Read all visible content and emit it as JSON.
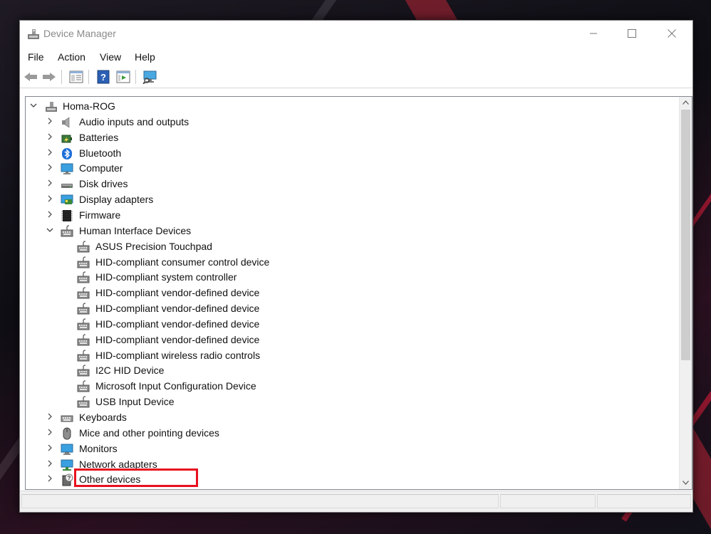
{
  "window": {
    "title": "Device Manager"
  },
  "menu": {
    "items": [
      "File",
      "Action",
      "View",
      "Help"
    ]
  },
  "toolbar": {
    "buttons": [
      "back-icon",
      "forward-icon",
      "properties-icon",
      "help-icon",
      "update-driver-icon",
      "scan-hardware-icon"
    ]
  },
  "tree": {
    "root": "Homa-ROG",
    "categories_before": [
      {
        "label": "Audio inputs and outputs",
        "icon": "speaker-icon"
      },
      {
        "label": "Batteries",
        "icon": "battery-icon"
      },
      {
        "label": "Bluetooth",
        "icon": "bluetooth-icon"
      },
      {
        "label": "Computer",
        "icon": "computer-icon"
      },
      {
        "label": "Disk drives",
        "icon": "disk-drive-icon"
      },
      {
        "label": "Display adapters",
        "icon": "display-adapter-icon"
      },
      {
        "label": "Firmware",
        "icon": "firmware-icon"
      }
    ],
    "expanded_category": {
      "label": "Human Interface Devices",
      "icon": "hid-icon"
    },
    "hid_children": [
      "ASUS Precision Touchpad",
      "HID-compliant consumer control device",
      "HID-compliant system controller",
      "HID-compliant vendor-defined device",
      "HID-compliant vendor-defined device",
      "HID-compliant vendor-defined device",
      "HID-compliant vendor-defined device",
      "HID-compliant wireless radio controls",
      "I2C HID Device",
      "Microsoft Input Configuration Device",
      "USB Input Device"
    ],
    "highlighted_item": "USB Input Device",
    "categories_after": [
      {
        "label": "Keyboards",
        "icon": "keyboard-icon"
      },
      {
        "label": "Mice and other pointing devices",
        "icon": "mouse-icon"
      },
      {
        "label": "Monitors",
        "icon": "monitor-icon"
      },
      {
        "label": "Network adapters",
        "icon": "network-adapter-icon"
      },
      {
        "label": "Other devices",
        "icon": "unknown-device-icon"
      }
    ]
  },
  "colors": {
    "highlight_box": "#e8101e",
    "window_bg": "#ffffff"
  }
}
